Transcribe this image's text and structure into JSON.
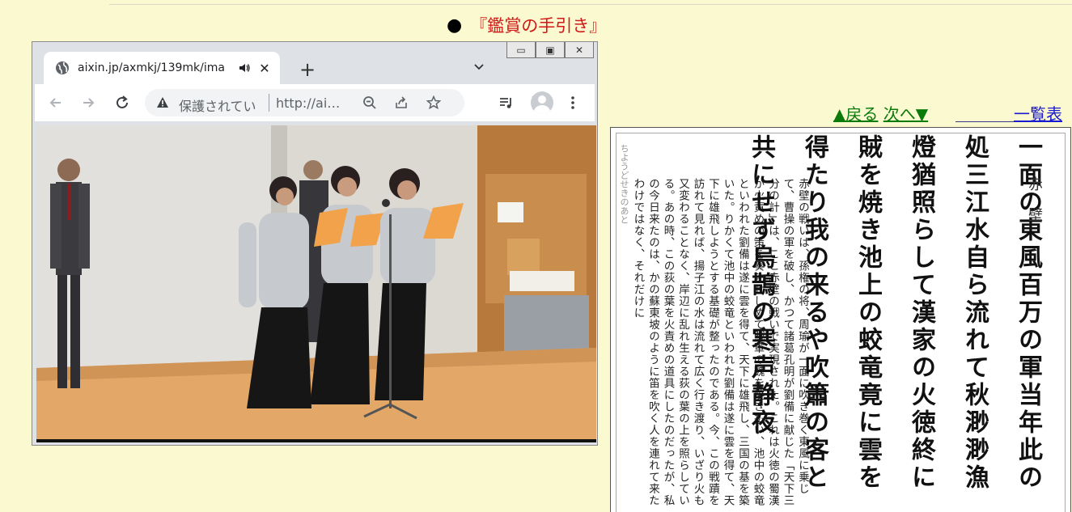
{
  "page": {
    "title": "『鑑賞の手引き』"
  },
  "browser": {
    "tab_title": "aixin.jp/axmkj/139mk/ima",
    "new_tab": "+",
    "tab_close": "✕",
    "address_security": "保護されてい",
    "address_url": "http://ai…",
    "window_controls": [
      "▭",
      "▣",
      "✕"
    ]
  },
  "nav": {
    "back_label": "▲戻る",
    "next_label": "次へ▼",
    "list_label": "一覧表"
  },
  "scan": {
    "title": "赤壁",
    "poem_text": "一面の東風百万の軍当年此の処三江水自ら流れて秋渺渺漁燈猶照らして漢家の火徳終に賊を焼き池上の蛟竜竟に雲を得たり我の来るや吹簫の客と共にせず烏鵲の寒声静夜",
    "prose_text": "赤壁の戦いは、孫権の将、周瑜が一面に吹き巻く東風に乗じて、曹操の軍を破し、かつて諸葛孔明が劉備に献じた「天下三分の計」は、ここ赤壁の戦いで実現された。これは火徳の蜀漢が火責めの策を奏功せしめて賊軍の魏を焼き払い、池中の蛟竜といわれた劉備は遂に雲を得て、天下に雄飛し、三国の基を築いた。りかくて池中の蛟竜といわれた劉備は遂に雲を得て、天下に雄飛しようとする基礎が整ったのである。今、この戦蹟を訪れて見れば、揚子江の水は流れて広く行き渡り、いざり火も又変わることなく、岸辺に乱れ生える荻の葉の上を照らしている。あの時、この荻の葉を火責めの道具にしたのだったが、私の今日来たのは、かの蘇東坡のように笛を吹く人を連れて来たわけではなく、それだけに",
    "side_note": "ちようどせきのあと"
  },
  "colors": {
    "background": "#fbf9cf",
    "title": "#d01818",
    "nav_link": "#0a7a0a",
    "list_link": "#1a1ad0"
  }
}
